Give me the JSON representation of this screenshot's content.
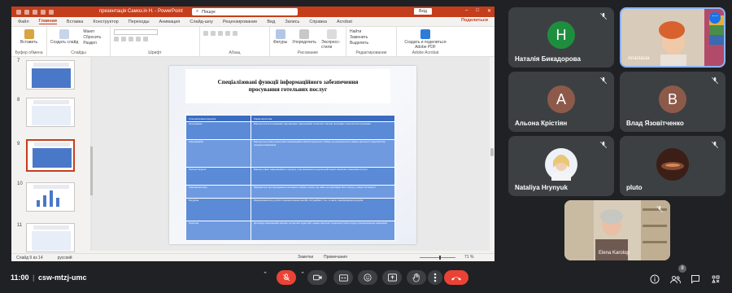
{
  "colors": {
    "ppt_accent": "#c43e1c",
    "meet_bg": "#202124",
    "tile_bg": "#3c4043",
    "end_call": "#ea4335",
    "table_header": "#3b6cc0",
    "table_row": "#5b8bd6"
  },
  "ppt": {
    "window_title": "презентація Самоз.in H.  -  PowerPoint",
    "search_placeholder": "Пошук",
    "sign_in": "Вхід",
    "tabs": [
      "Файл",
      "Главная",
      "Вставка",
      "Конструктор",
      "Переходы",
      "Анимация",
      "Слайд-шоу",
      "Рецензирование",
      "Вид",
      "Запись",
      "Справка",
      "Acrobat"
    ],
    "share_label": "Поделиться",
    "ribbon": {
      "paste": "Вставить",
      "clipboard": "Буфер обмена",
      "new_slide": "Создать слайд",
      "layout": "Макет",
      "reset": "Сбросить",
      "section": "Раздел",
      "slides": "Слайды",
      "font": "Шрифт",
      "paragraph": "Абзац",
      "shapes": "Фигуры",
      "arrange": "Упорядочить",
      "quick_styles": "Экспресс-стили",
      "drawing": "Рисование",
      "find": "Найти",
      "replace": "Заменить",
      "select": "Выделить",
      "editing": "Редактирование",
      "create_pdf": "Создать и поделиться Adobe PDF",
      "adobe": "Adobe Acrobat"
    },
    "slide_numbers": [
      "7",
      "8",
      "9",
      "10",
      "11"
    ],
    "slide": {
      "title": "Спеціалізовані функції інформаційного забезпечення просування готельних послуг",
      "table_headers": [
        "Спеціалізована функція",
        "Характеристика"
      ],
      "table_rows": [
        [
          "Інтегрування",
          "Виконується інтегрованими підрозділами; інформаційні технології і методи програмно-технологічної підтримки"
        ],
        [
          "Інформаційна",
          "Виконується усіма елементами інформаційно-забезпечувального обміну, що реалізується в рамках діяльності підприємства, передача інформації"
        ],
        [
          "Прогностикуюча",
          "Виконує ефект інформаційного процесу, тому визначається детальний аналіз кількісних показників послуги"
        ],
        [
          "Самопрезентація",
          "Відбувається при формуванні позитивного образу готелю, що навіть не відповідає його статусу у сфері гостинності"
        ],
        [
          "Ресурсна",
          "Виокремлюються у роботі з використанням засобів, ситуаційних і т.ін., а також трансформація ресурсів"
        ],
        [
          "Оціночна",
          "Досліджує інформаційні масиви, контактних аудиторій, оцінює результат подальшої роботи щодо розповсюдження інформації"
        ]
      ]
    },
    "status": {
      "slide_of": "Слайд 9 из 14",
      "language": "русский",
      "notes": "Заметки",
      "comments": "Примечания",
      "zoom": "71 %"
    }
  },
  "participants": [
    {
      "name": "Наталія Бикадорова",
      "initial": "Н",
      "avatar_color": "#1e8e3e",
      "muted": true
    },
    {
      "name": "Anastasia",
      "initial": "",
      "avatar_color": "#c7a58a",
      "muted": false,
      "video": true
    },
    {
      "name": "Альона Крістіян",
      "initial": "А",
      "avatar_color": "#8d5a4a",
      "muted": true
    },
    {
      "name": "Влад Язовітченко",
      "initial": "В",
      "avatar_color": "#8d5a4a",
      "muted": true
    },
    {
      "name": "Nataliya Hrynyuk",
      "initial": "",
      "avatar_color": "#f0c8a8",
      "muted": true,
      "photo": true
    },
    {
      "name": "pluto",
      "initial": "",
      "avatar_color": "#6b3a2a",
      "muted": true,
      "photo": true
    },
    {
      "name": "Elena Karolop",
      "initial": "",
      "avatar_color": "#d7ccb8",
      "muted": true,
      "video": true
    }
  ],
  "meet": {
    "time": "11:00",
    "separator": "|",
    "code": "csw-mtzj-umc",
    "people_count": "8"
  },
  "icons": [
    "mic-off-icon",
    "chevron-up-icon",
    "camera-icon",
    "captions-icon",
    "emoji-icon",
    "present-icon",
    "raise-hand-icon",
    "more-vert-icon",
    "call-end-icon",
    "info-icon",
    "people-icon",
    "chat-icon",
    "activities-icon"
  ]
}
